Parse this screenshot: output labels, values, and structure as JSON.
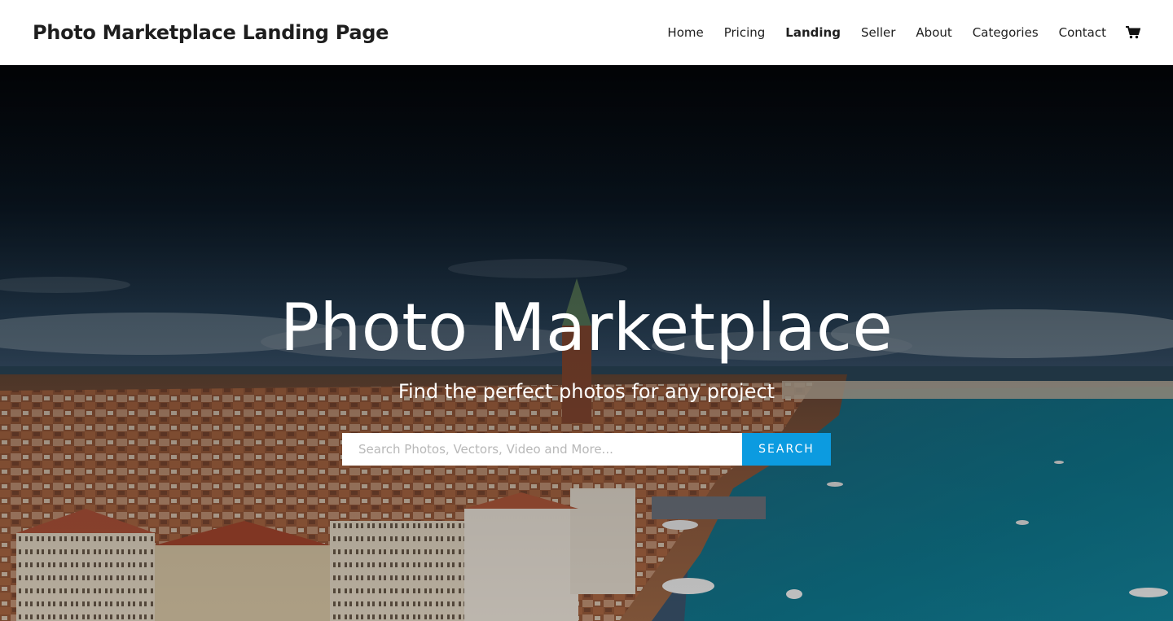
{
  "header": {
    "site_title": "Photo Marketplace Landing Page",
    "nav": [
      {
        "label": "Home"
      },
      {
        "label": "Pricing"
      },
      {
        "label": "Landing",
        "active": true
      },
      {
        "label": "Seller"
      },
      {
        "label": "About"
      },
      {
        "label": "Categories"
      },
      {
        "label": "Contact"
      }
    ],
    "cart_icon": "shopping-cart-icon"
  },
  "hero": {
    "title": "Photo Marketplace",
    "subtitle": "Find the perfect photos for any project",
    "search": {
      "placeholder": "Search Photos, Vectors, Video and More...",
      "value": "",
      "button_label": "SEARCH"
    },
    "background_image": "aerial view of Venice, Italy — bell tower, terracotta rooftops and lagoon with boats"
  },
  "colors": {
    "accent": "#0c9be0",
    "header_bg": "#ffffff",
    "text_dark": "#1e1e1e"
  }
}
